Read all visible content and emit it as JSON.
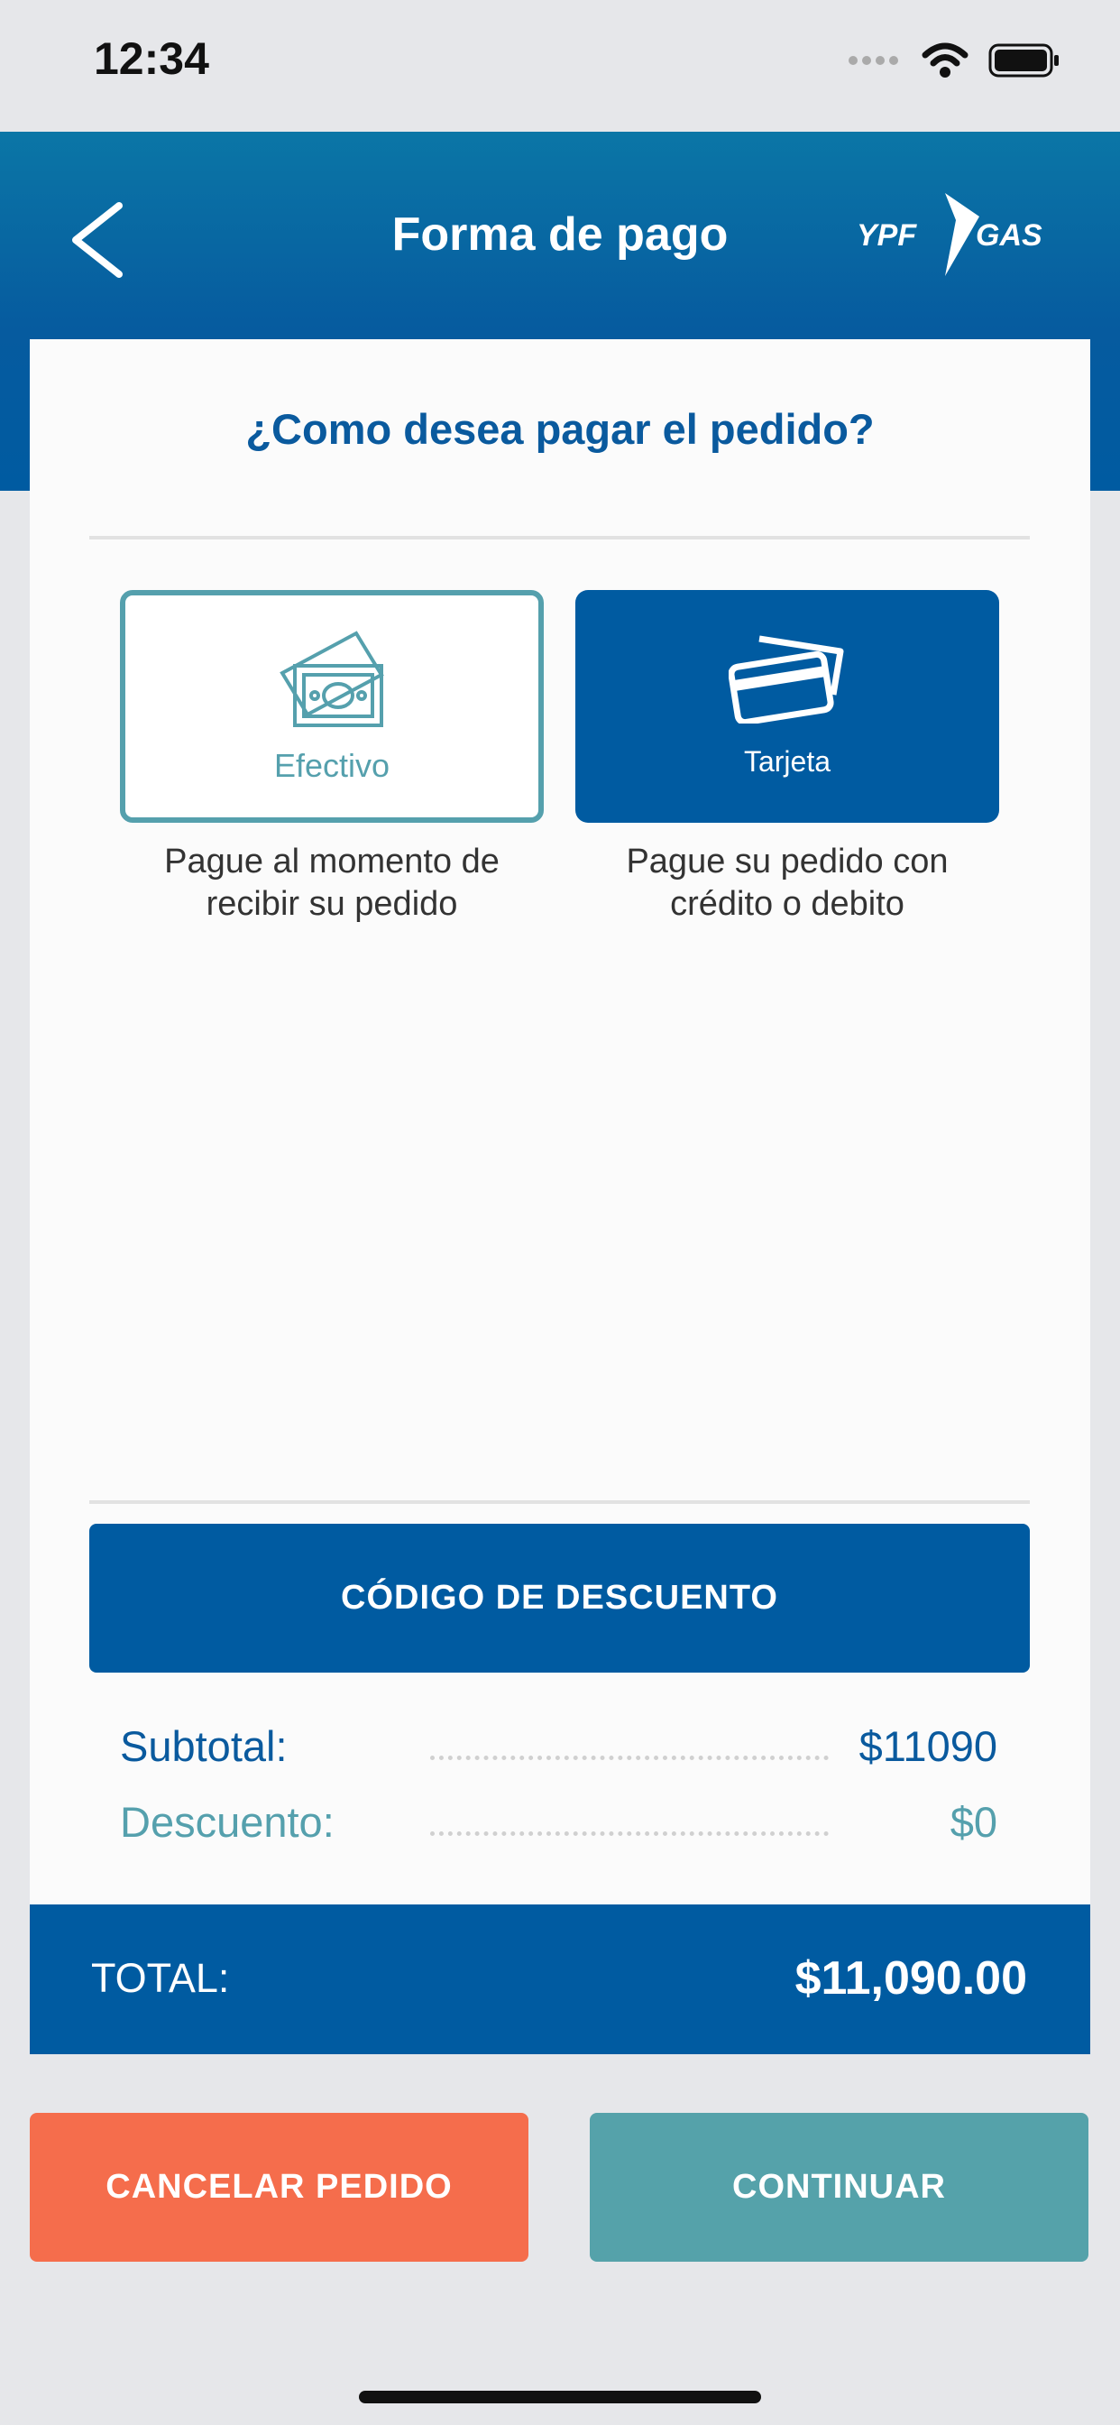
{
  "status_bar": {
    "time": "12:34"
  },
  "header": {
    "title": "Forma de pago",
    "logo_left": "YPF",
    "logo_right": "GAS"
  },
  "card": {
    "question": "¿Como desea pagar el pedido?",
    "options": [
      {
        "label": "Efectivo",
        "description": "Pague al momento de recibir su pedido",
        "selected": true
      },
      {
        "label": "Tarjeta",
        "description": "Pague su pedido con crédito o debito",
        "selected": false
      }
    ],
    "discount_label": "CÓDIGO DE DESCUENTO",
    "summary": {
      "subtotal_label": "Subtotal:",
      "subtotal_value": "$11090",
      "discount_label": "Descuento:",
      "discount_value": "$0"
    }
  },
  "total": {
    "label": "TOTAL:",
    "value": "$11,090.00"
  },
  "actions": {
    "cancel_label": "CANCELAR PEDIDO",
    "continue_label": "CONTINUAR"
  },
  "colors": {
    "primary": "#005ba1",
    "teal": "#55a2aa",
    "cancel": "#f56d4c",
    "background": "#e6e7ea"
  },
  "icons": [
    "back-chevron-icon",
    "ypf-gas-logo",
    "cash-icon",
    "credit-card-icon",
    "wifi-icon",
    "battery-icon",
    "signal-icon"
  ]
}
